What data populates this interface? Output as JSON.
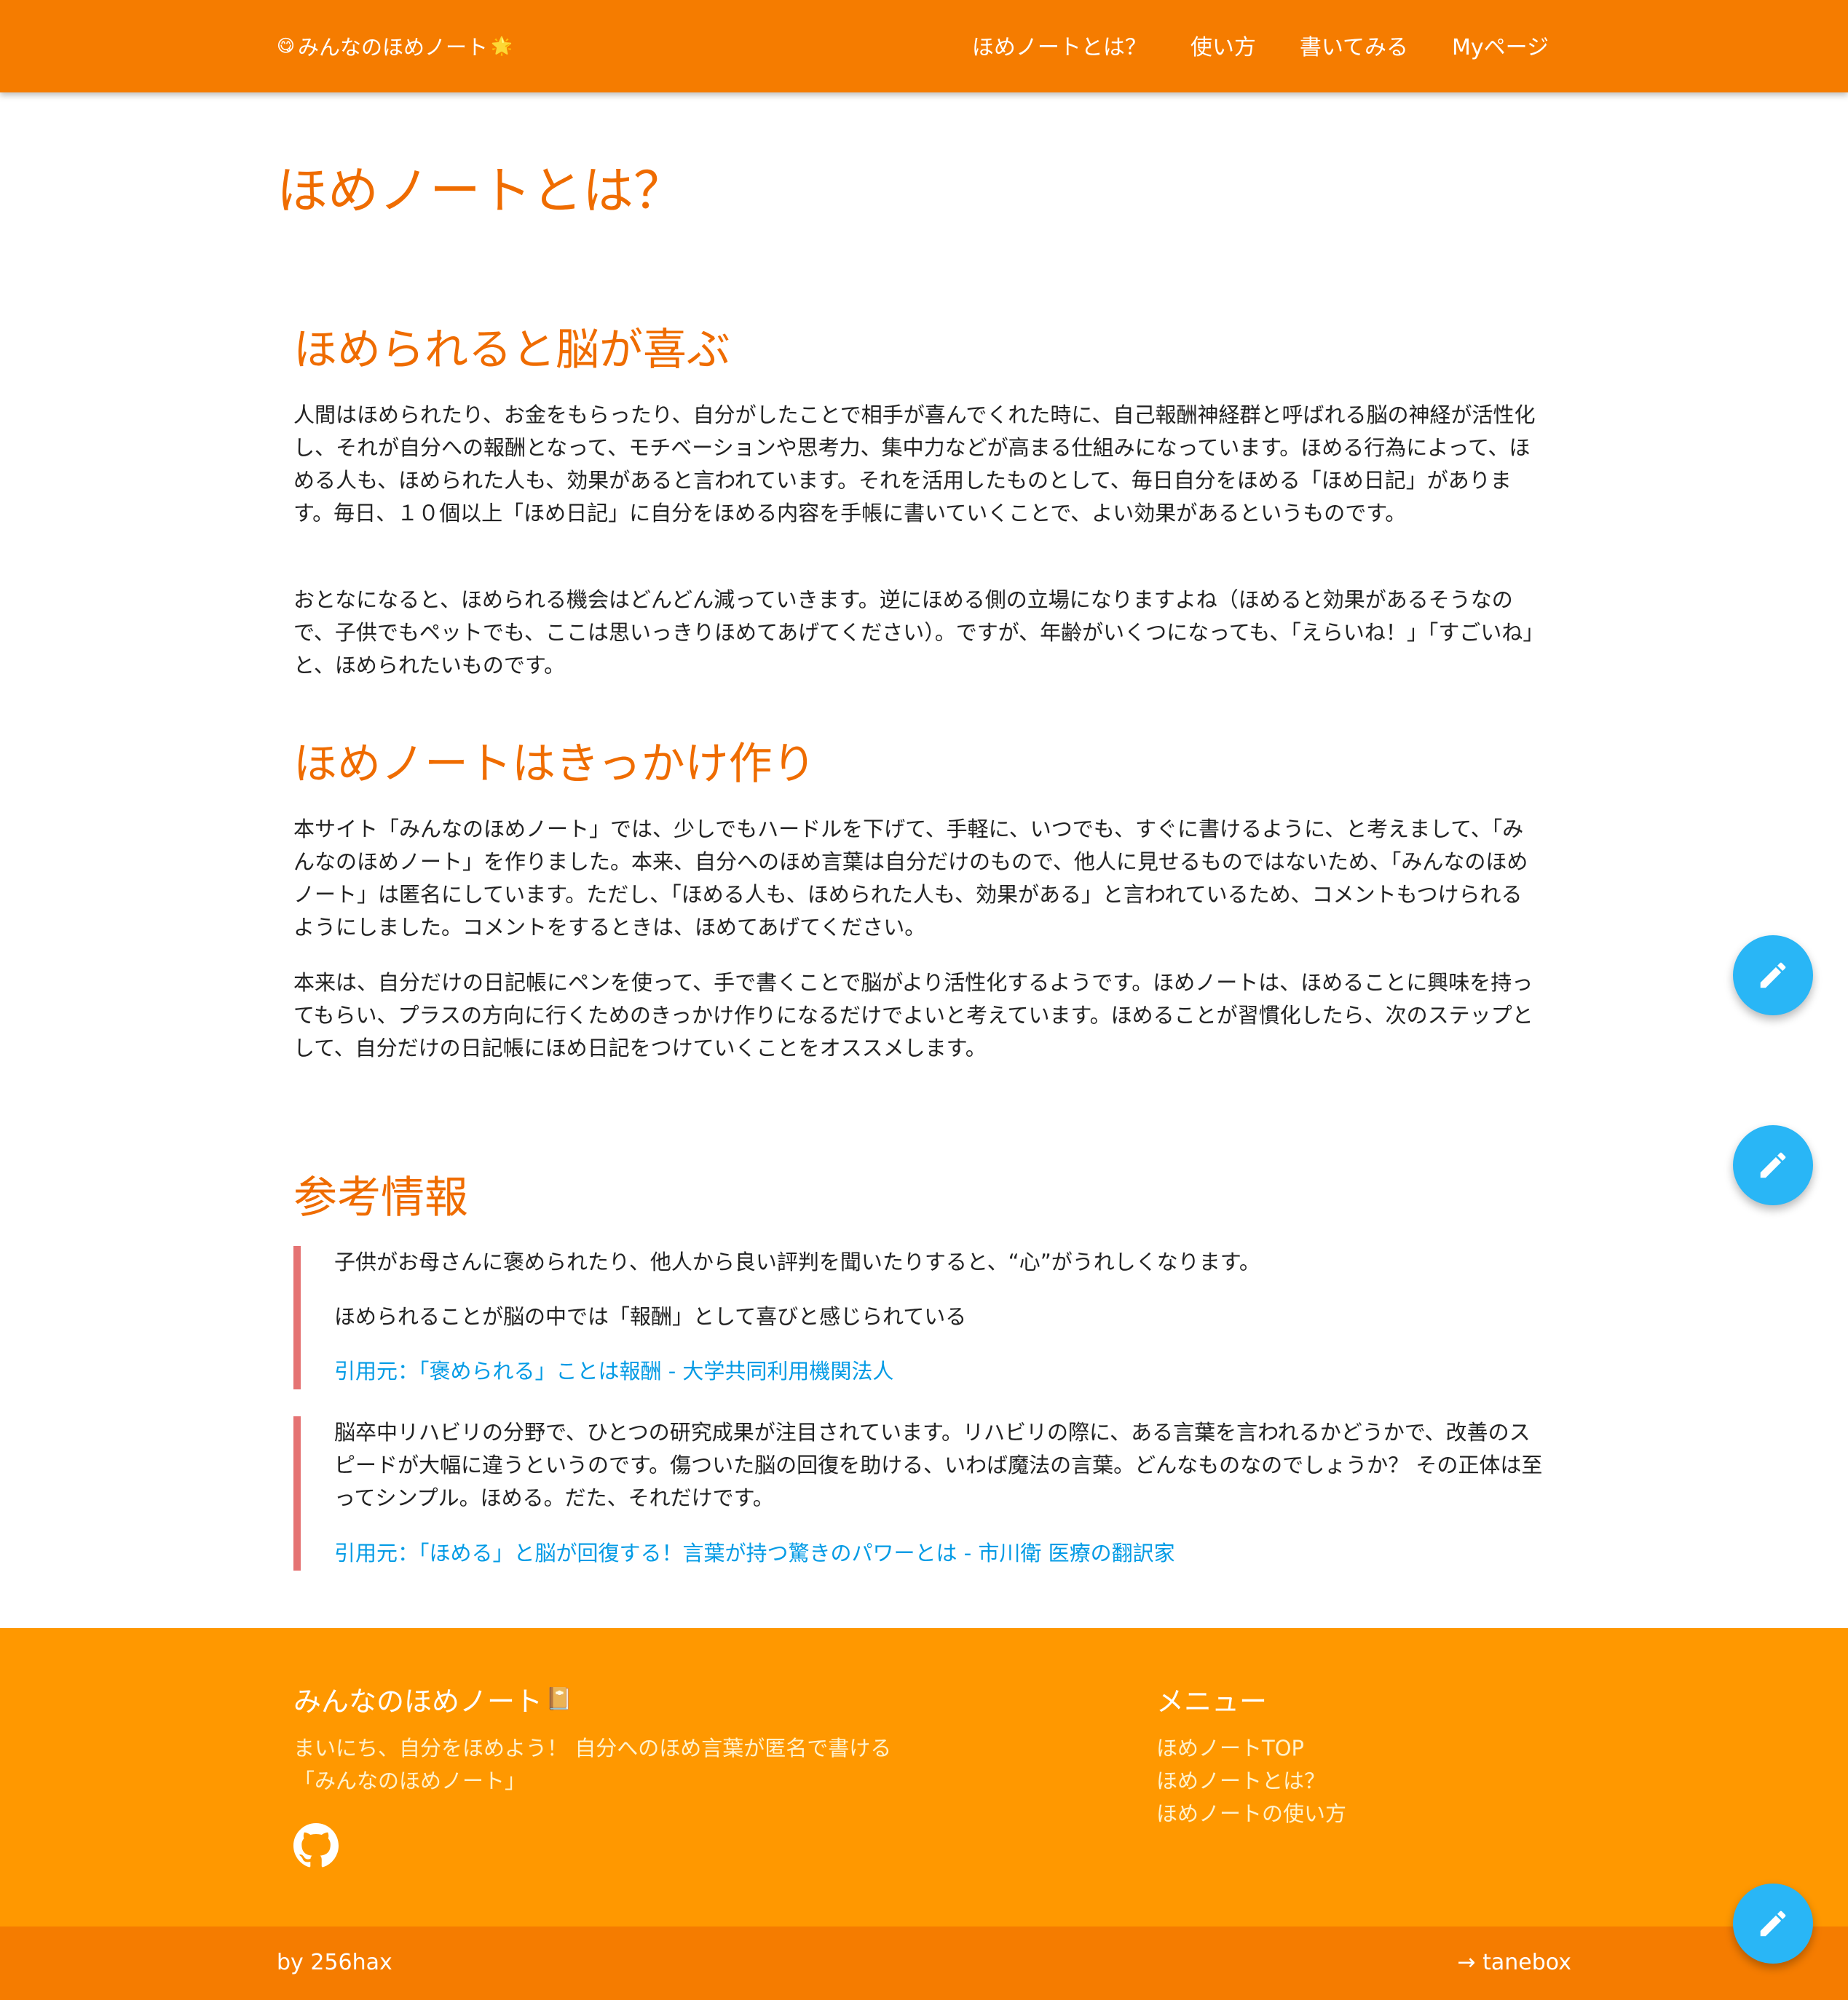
{
  "header": {
    "brand_emoji_left": "😋",
    "brand": "みんなのほめノート",
    "brand_emoji_right": "🌟",
    "nav": [
      "ほめノートとは？",
      "使い方",
      "書いてみる",
      "Myページ"
    ]
  },
  "page_title": "ほめノートとは？",
  "sections": [
    {
      "heading": "ほめられると脳が喜ぶ",
      "paragraphs": [
        "人間はほめられたり、お金をもらったり、自分がしたことで相手が喜んでくれた時に、自己報酬神経群と呼ばれる脳の神経が活性化し、それが自分への報酬となって、モチベーションや思考力、集中力などが高まる仕組みになっています。ほめる行為によって、ほめる人も、ほめられた人も、効果があると言われています。それを活用したものとして、毎日自分をほめる「ほめ日記」があります。毎日、１０個以上「ほめ日記」に自分をほめる内容を手帳に書いていくことで、よい効果があるというものです。",
        "おとなになると、ほめられる機会はどんどん減っていきます。逆にほめる側の立場になりますよね（ほめると効果があるそうなので、子供でもペットでも、ここは思いっきりほめてあげてください）。ですが、年齢がいくつになっても、「えらいね！」「すごいね」と、ほめられたいものです。"
      ]
    },
    {
      "heading": "ほめノートはきっかけ作り",
      "paragraphs": [
        "本サイト「みんなのほめノート」では、少しでもハードルを下げて、手軽に、いつでも、すぐに書けるように、と考えまして、「みんなのほめノート」を作りました。本来、自分へのほめ言葉は自分だけのもので、他人に見せるものではないため、「みんなのほめノート」は匿名にしています。ただし、「ほめる人も、ほめられた人も、効果がある」と言われているため、コメントもつけられるようにしました。コメントをするときは、ほめてあげてください。",
        "本来は、自分だけの日記帳にペンを使って、手で書くことで脳がより活性化するようです。ほめノートは、ほめることに興味を持ってもらい、プラスの方向に行くためのきっかけ作りになるだけでよいと考えています。ほめることが習慣化したら、次のステップとして、自分だけの日記帳にほめ日記をつけていくことをオススメします。"
      ]
    },
    {
      "heading": "参考情報",
      "quotes": [
        {
          "lines": [
            "子供がお母さんに褒められたり、他人から良い評判を聞いたりすると、“心”がうれしくなります。",
            "ほめられることが脳の中では「報酬」として喜びと感じられている"
          ],
          "source": "引用元：「褒められる」ことは報酬 - 大学共同利用機関法人"
        },
        {
          "lines": [
            "脳卒中リハビリの分野で、ひとつの研究成果が注目されています。リハビリの際に、ある言葉を言われるかどうかで、改善のスピードが大幅に違うというのです。傷ついた脳の回復を助ける、いわば魔法の言葉。どんなものなのでしょうか？ その正体は至ってシンプル。ほめる。だた、それだけです。"
          ],
          "source": "引用元：「ほめる」と脳が回復する！言葉が持つ驚きのパワーとは - 市川衛 医療の翻訳家"
        }
      ]
    }
  ],
  "footer": {
    "title": "みんなのほめノート",
    "title_emoji": "📔",
    "description": "まいにち、自分をほめよう！ 自分へのほめ言葉が匿名で書ける「みんなのほめノート」",
    "github_icon": "github-icon",
    "menu_title": "メニュー",
    "menu": [
      "ほめノートTOP",
      "ほめノートとは？",
      "ほめノートの使い方"
    ],
    "credit": "by 256hax",
    "right_link": "→ tanebox"
  },
  "fab_icon": "pencil-icon",
  "colors": {
    "header": "#f57c00",
    "accent_text": "#ef6c00",
    "footer": "#ff9800",
    "quote_border": "#e57373",
    "link": "#039be5",
    "fab": "#29b6f6"
  }
}
